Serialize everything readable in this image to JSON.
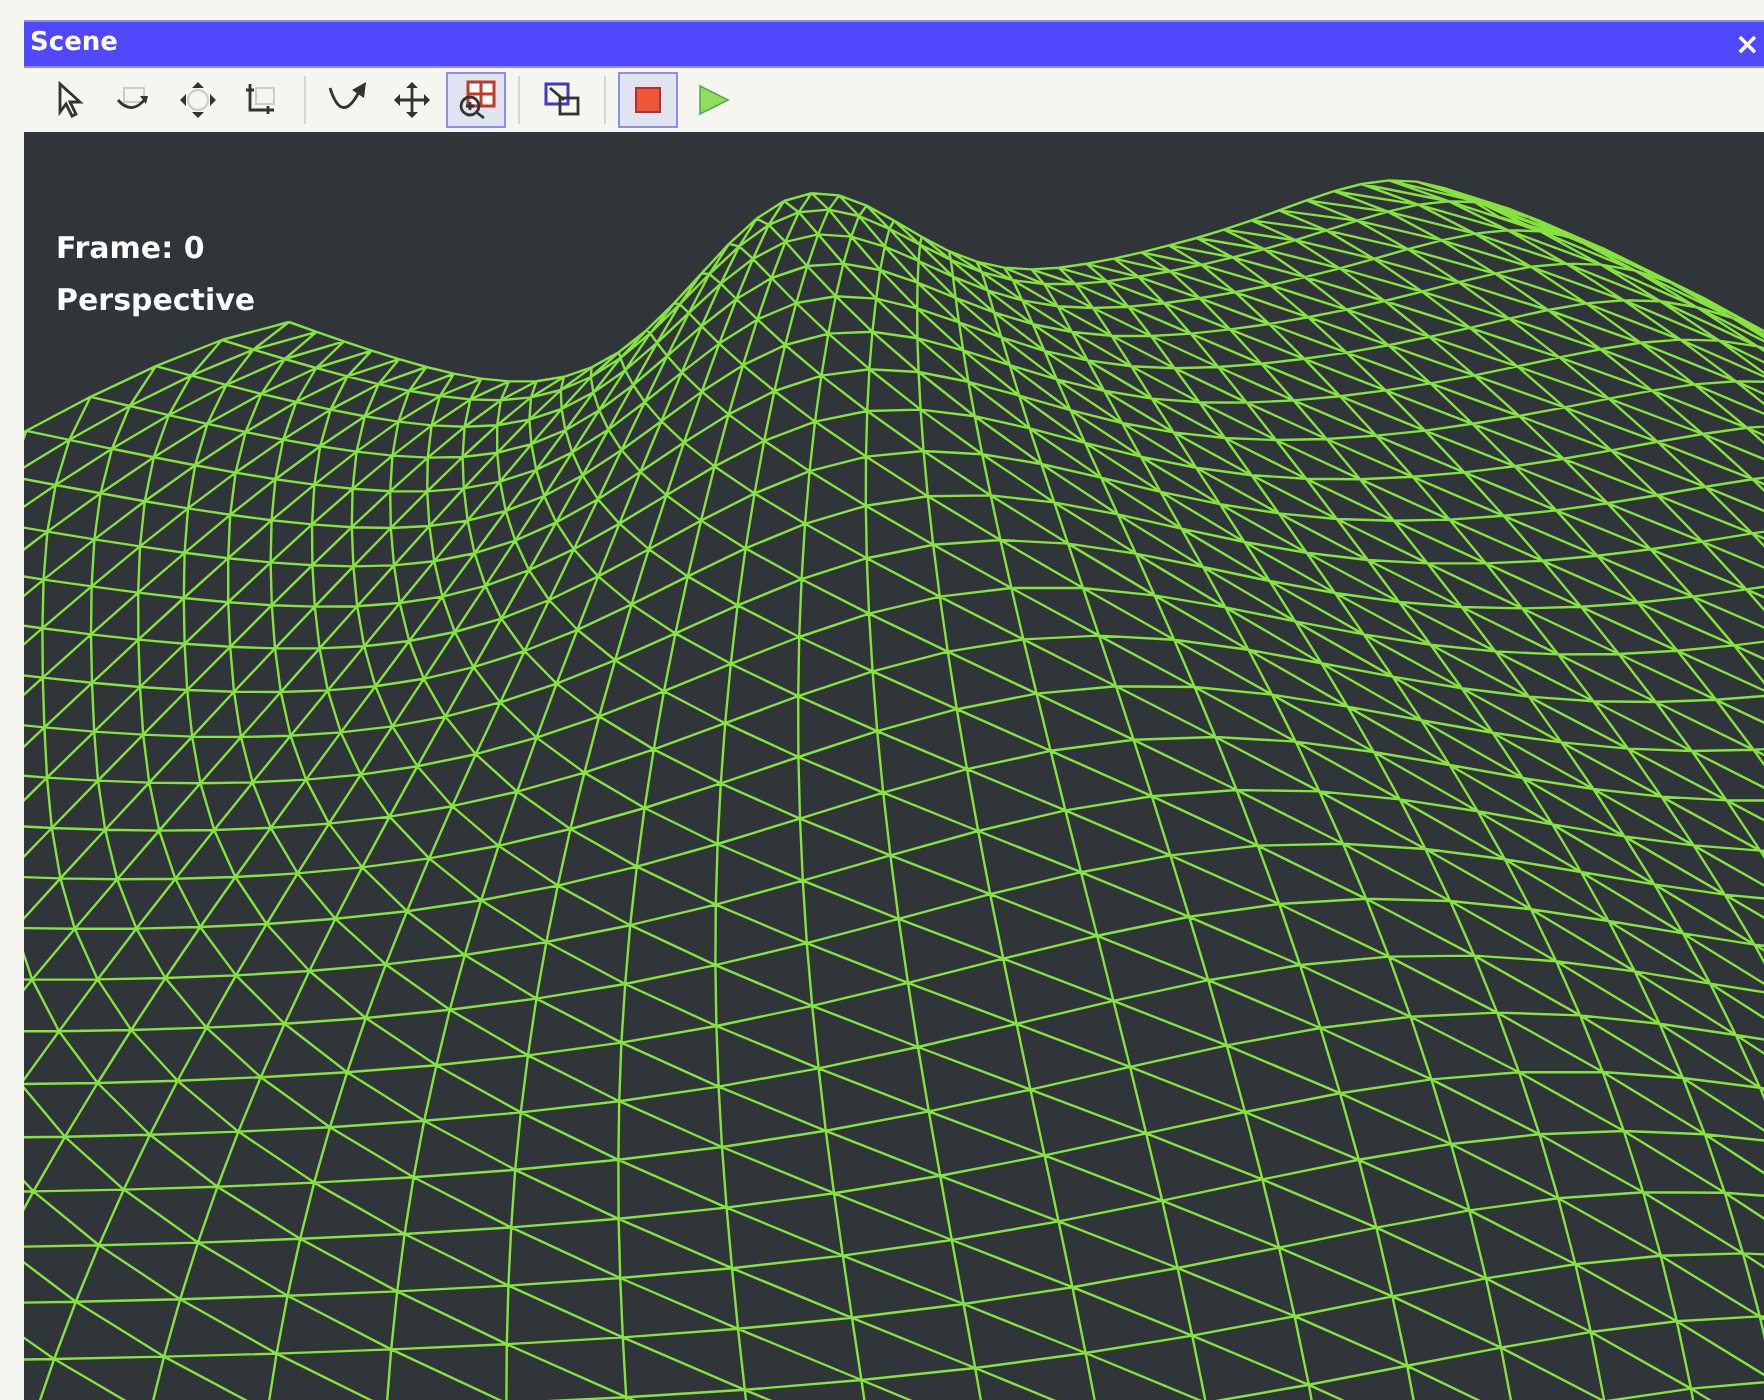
{
  "window": {
    "title": "Scene",
    "close": "×"
  },
  "toolbar": [
    {
      "kind": "select",
      "selected": false
    },
    {
      "kind": "orbit",
      "selected": false
    },
    {
      "kind": "move",
      "selected": false
    },
    {
      "kind": "scale",
      "selected": false
    },
    {
      "kind": "separator"
    },
    {
      "kind": "rotate",
      "selected": false
    },
    {
      "kind": "pan",
      "selected": false
    },
    {
      "kind": "zoom-region",
      "selected": true
    },
    {
      "kind": "separator"
    },
    {
      "kind": "zoom-extents",
      "selected": false
    },
    {
      "kind": "separator"
    },
    {
      "kind": "stop",
      "selected": true
    },
    {
      "kind": "play",
      "selected": false
    }
  ],
  "viewport": {
    "frame": "Frame: 0",
    "view": "Perspective"
  }
}
